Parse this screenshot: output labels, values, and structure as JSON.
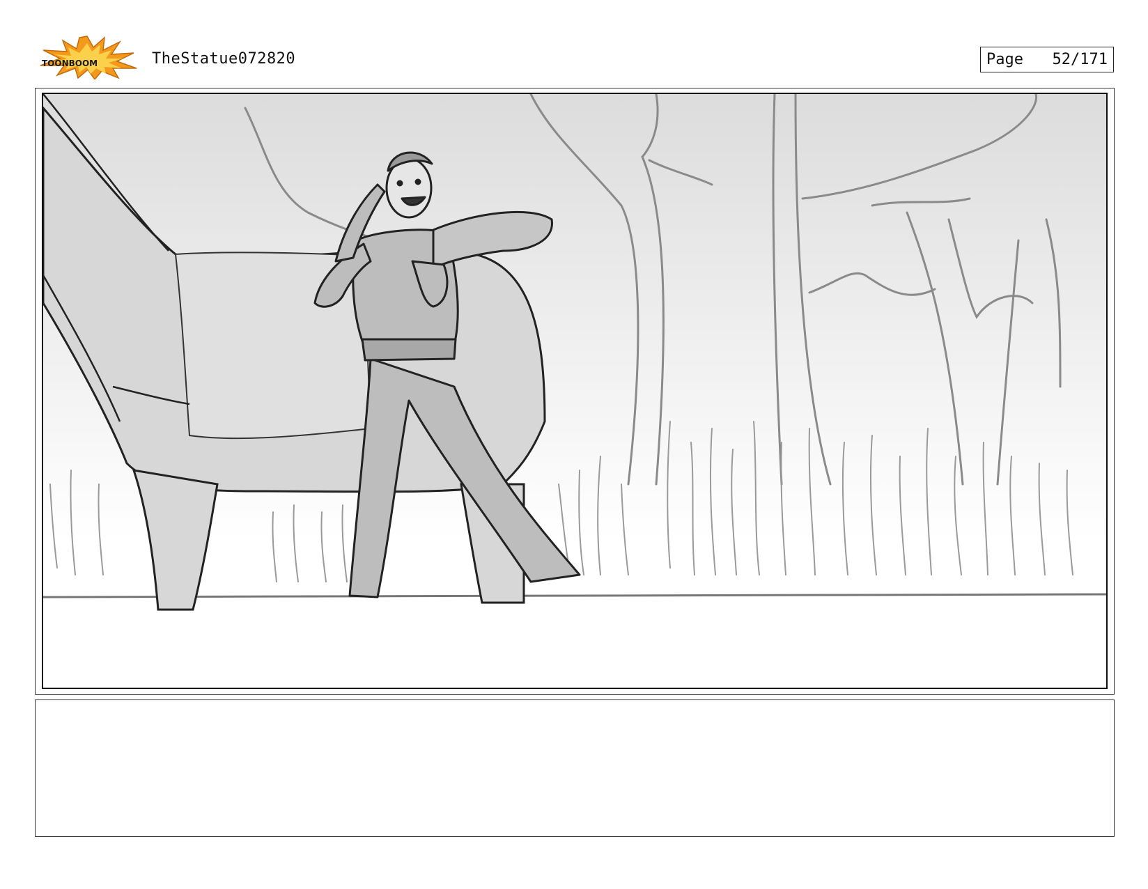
{
  "header": {
    "logo_text": "TOONBOOM",
    "logo_icon": "toonboom-logo-icon",
    "document_title": "TheStatue072820",
    "page_label": "Page",
    "page_number": "52/171"
  },
  "panel": {
    "image_icon": "storyboard-sketch-image"
  },
  "notes": {
    "text": ""
  }
}
